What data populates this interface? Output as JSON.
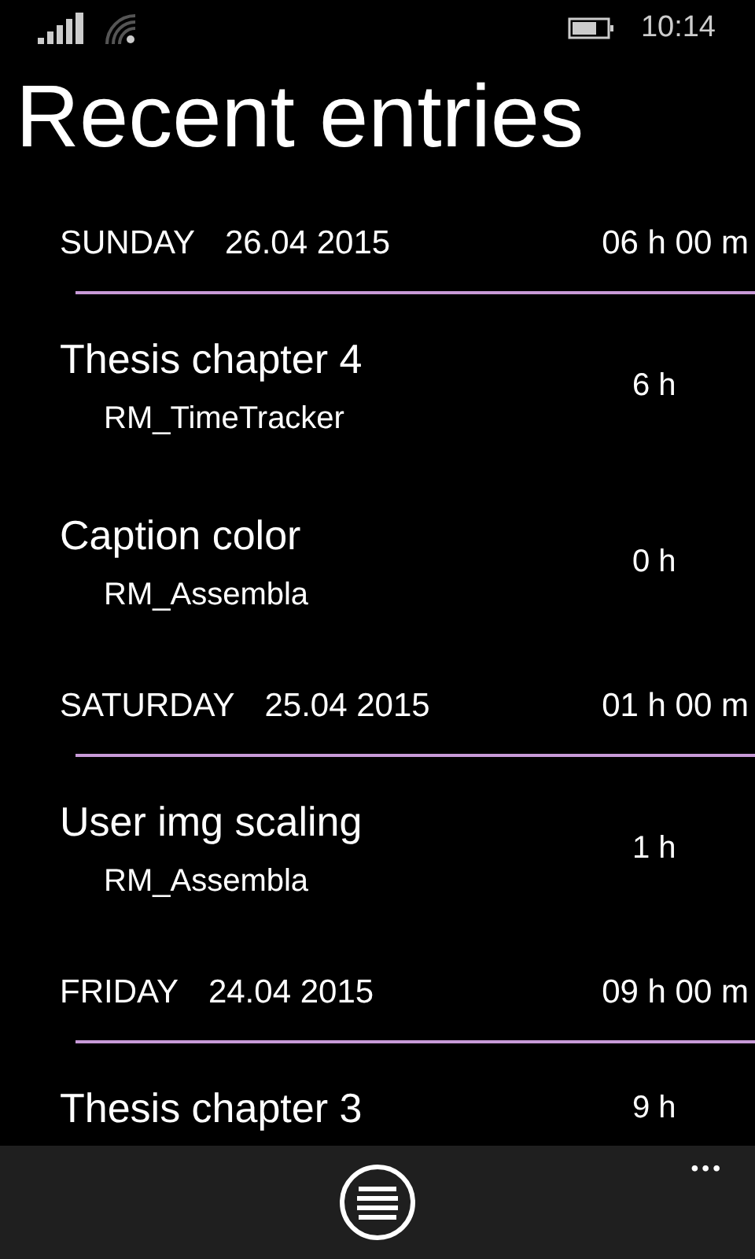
{
  "status_bar": {
    "time": "10:14"
  },
  "title": "Recent entries",
  "groups": [
    {
      "day": "SUNDAY",
      "date": "26.04 2015",
      "total": "06 h 00 m",
      "entries": [
        {
          "title": "Thesis chapter 4",
          "project": "RM_TimeTracker",
          "hours": "6 h"
        },
        {
          "title": "Caption color",
          "project": "RM_Assembla",
          "hours": "0 h"
        }
      ]
    },
    {
      "day": "SATURDAY",
      "date": "25.04 2015",
      "total": "01 h 00 m",
      "entries": [
        {
          "title": "User img scaling",
          "project": "RM_Assembla",
          "hours": "1 h"
        }
      ]
    },
    {
      "day": "FRIDAY",
      "date": "24.04 2015",
      "total": "09 h 00 m",
      "entries": [
        {
          "title": "Thesis chapter 3",
          "hours": "9 h"
        }
      ]
    }
  ],
  "app_bar": {
    "more": "•••"
  }
}
